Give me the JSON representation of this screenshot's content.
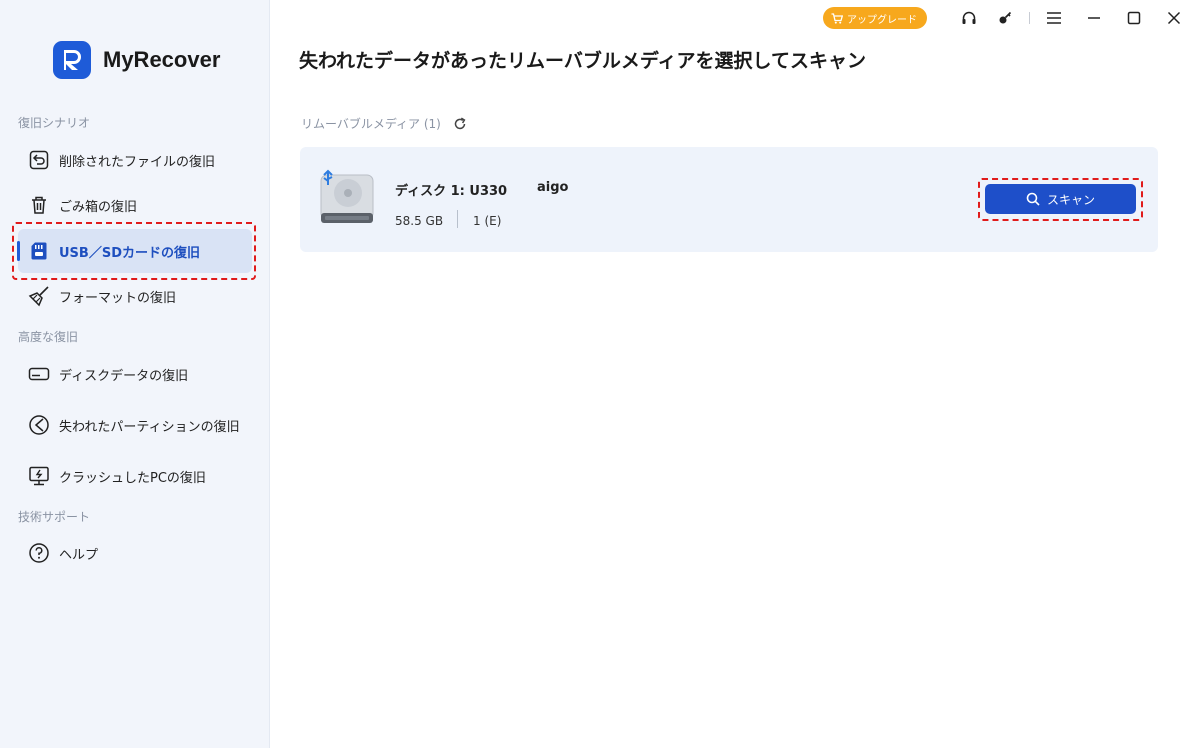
{
  "app": {
    "name": "MyRecover"
  },
  "topbar": {
    "upgrade_label": "アップグレード"
  },
  "sidebar": {
    "sections": [
      {
        "label": "復旧シナリオ"
      },
      {
        "label": "高度な復旧"
      },
      {
        "label": "技術サポート"
      }
    ],
    "items": [
      {
        "label": "削除されたファイルの復旧",
        "icon": "undo-icon"
      },
      {
        "label": "ごみ箱の復旧",
        "icon": "trash-icon"
      },
      {
        "label": "USB／SDカードの復旧",
        "icon": "sd-card-icon",
        "active": true
      },
      {
        "label": "フォーマットの復旧",
        "icon": "broom-icon"
      },
      {
        "label": "ディスクデータの復旧",
        "icon": "hard-disk-icon"
      },
      {
        "label": "失われたパーティションの復旧",
        "icon": "partition-icon"
      },
      {
        "label": "クラッシュしたPCの復旧",
        "icon": "crashed-pc-icon"
      },
      {
        "label": "ヘルプ",
        "icon": "help-icon"
      }
    ]
  },
  "main": {
    "title": "失われたデータがあったリムーバブルメディアを選択してスキャン",
    "media_label": "リムーバブルメディア (1)",
    "disk": {
      "name": "ディスク 1: U330",
      "vendor": "aigo",
      "size": "58.5 GB",
      "partition": "1 (E)"
    },
    "scan_label": "スキャン"
  },
  "colors": {
    "accent": "#1e5bd8",
    "upgrade": "#f7a81d",
    "highlight": "#e01b1b"
  }
}
